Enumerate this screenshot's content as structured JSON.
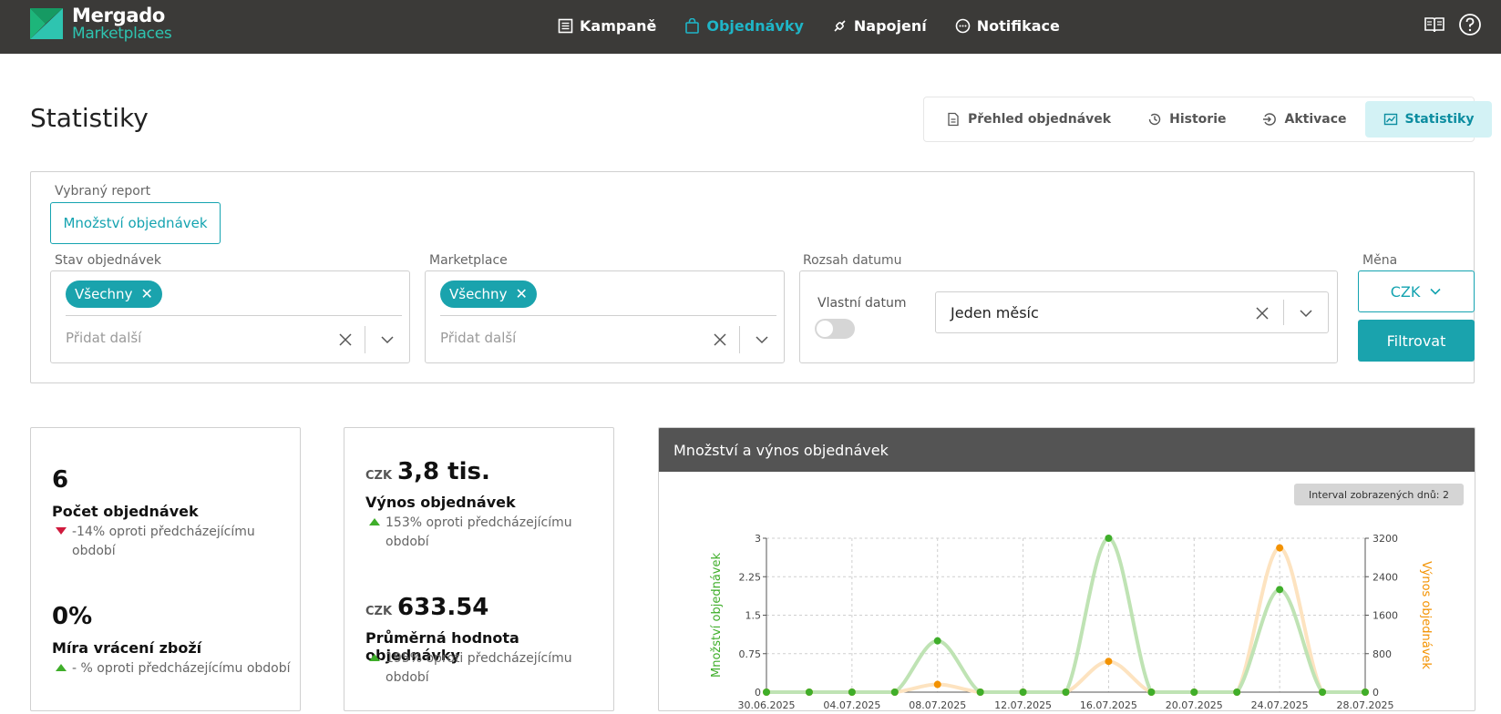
{
  "brand": {
    "line1": "Mergado",
    "line2": "Marketplaces"
  },
  "nav": [
    {
      "label": "Kampaně",
      "icon": "list-icon"
    },
    {
      "label": "Objednávky",
      "icon": "bag-icon",
      "active": true
    },
    {
      "label": "Napojení",
      "icon": "plug-icon"
    },
    {
      "label": "Notifikace",
      "icon": "chat-icon"
    }
  ],
  "top_right": {
    "docs_icon": "book-icon",
    "help_icon": "help-icon"
  },
  "page": {
    "title": "Statistiky"
  },
  "tabs": [
    {
      "label": "Přehled objednávek",
      "icon": "document-icon"
    },
    {
      "label": "Historie",
      "icon": "history-icon"
    },
    {
      "label": "Aktivace",
      "icon": "activation-icon"
    },
    {
      "label": "Statistiky",
      "icon": "chart-icon",
      "active": true
    }
  ],
  "filters": {
    "report_label": "Vybraný report",
    "report_value": "Množství objednávek",
    "status": {
      "label": "Stav objednávek",
      "chip": "Všechny",
      "placeholder": "Přidat další"
    },
    "marketplace": {
      "label": "Marketplace",
      "chip": "Všechny",
      "placeholder": "Přidat další"
    },
    "date_range": {
      "label": "Rozsah datumu",
      "custom_label": "Vlastní datum",
      "custom_enabled": false,
      "value": "Jeden měsíc"
    },
    "currency": {
      "label": "Měna",
      "value": "CZK"
    },
    "submit_label": "Filtrovat"
  },
  "kpis": {
    "orders": {
      "value": "6",
      "title": "Počet objednávek",
      "trend": "-14% oproti předcházejícímu období",
      "direction": "down"
    },
    "returns": {
      "value": "0%",
      "title": "Míra vrácení zboží",
      "trend": "- % oproti předcházejícímu období",
      "direction": "up"
    },
    "revenue": {
      "currency": "CZK",
      "value": "3,8 tis.",
      "title": "Výnos objednávek",
      "trend": "153% oproti předcházejícímu období",
      "direction": "up"
    },
    "avg_order": {
      "currency": "CZK",
      "value": "633.54",
      "title": "Průměrná hodnota objednávky",
      "trend": "195% oproti předcházejícímu období",
      "direction": "up"
    }
  },
  "chart_panel": {
    "title": "Množství a výnos objednávek",
    "interval_badge": "Interval zobrazených dnů: 2"
  },
  "chart_data": {
    "type": "line",
    "x": [
      "30.06.2025",
      "02.07.2025",
      "04.07.2025",
      "06.07.2025",
      "08.07.2025",
      "10.07.2025",
      "12.07.2025",
      "14.07.2025",
      "16.07.2025",
      "18.07.2025",
      "20.07.2025",
      "22.07.2025",
      "24.07.2025",
      "26.07.2025",
      "28.07.2025"
    ],
    "x_tick_labels": [
      "30.06.2025",
      "04.07.2025",
      "08.07.2025",
      "12.07.2025",
      "16.07.2025",
      "20.07.2025",
      "24.07.2025",
      "28.07.2025"
    ],
    "series": [
      {
        "name": "Množství objednávek",
        "axis": "left",
        "color": "#3fae2a",
        "line_color": "#bfe3b4",
        "values": [
          0,
          0,
          0,
          0,
          1,
          0,
          0,
          0,
          3,
          0,
          0,
          0,
          2,
          0,
          0
        ]
      },
      {
        "name": "Výnos objednávek",
        "axis": "right",
        "color": "#f39200",
        "line_color": "#fde3c0",
        "values": [
          0,
          0,
          0,
          0,
          160,
          0,
          0,
          0,
          640,
          0,
          0,
          0,
          3000,
          0,
          0
        ]
      }
    ],
    "ylabel_left": "Množství objednávek",
    "ylabel_right": "Výnos objednávek",
    "ylim_left": [
      0,
      3
    ],
    "ylim_right": [
      0,
      3200
    ],
    "yticks_left": [
      "0",
      "0.75",
      "1.5",
      "2.25",
      "3"
    ],
    "yticks_right": [
      "0",
      "800",
      "1600",
      "2400",
      "3200"
    ],
    "grid": true
  }
}
